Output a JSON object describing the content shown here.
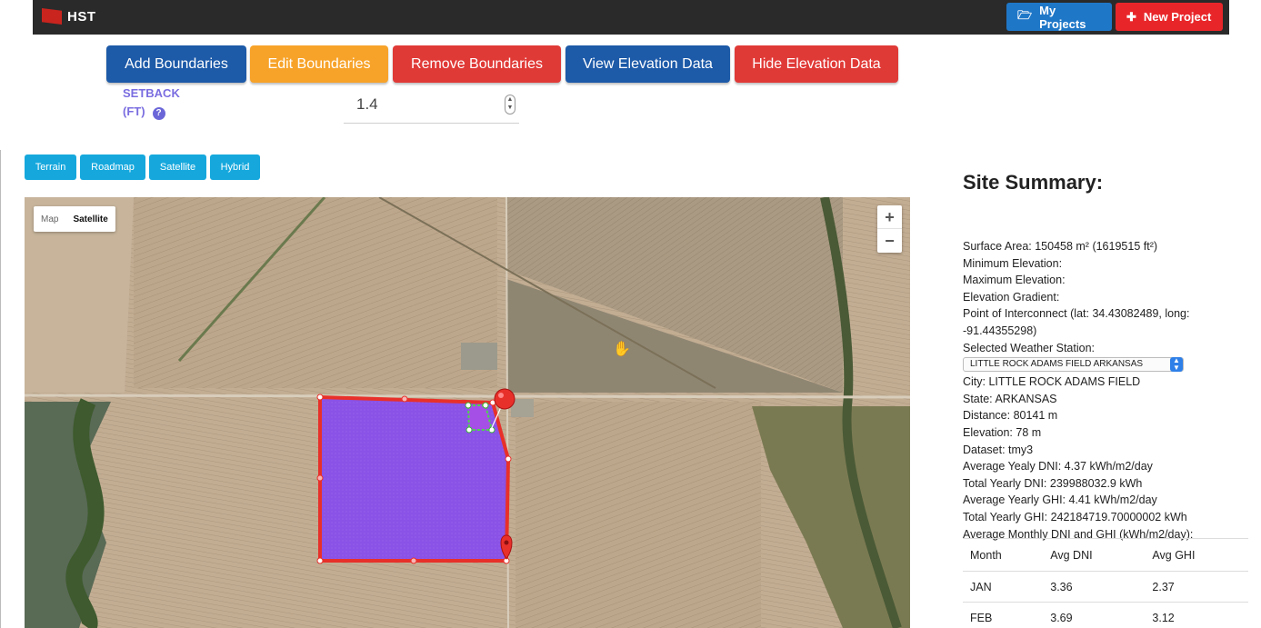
{
  "app": {
    "name": "HST"
  },
  "nav": {
    "my_projects": "My Projects",
    "new_project": "New Project",
    "projects_icon": "folder-open-icon",
    "new_icon": "plus-icon"
  },
  "actions": {
    "add": "Add Boundaries",
    "edit": "Edit Boundaries",
    "remove": "Remove Boundaries",
    "view": "View Elevation Data",
    "hide": "Hide Elevation Data"
  },
  "setback": {
    "label_line1": "SETBACK",
    "label_line2": "(FT)",
    "value": "1.4",
    "help_icon": "question-circle-icon"
  },
  "map_types": [
    "Terrain",
    "Roadmap",
    "Satellite",
    "Hybrid"
  ],
  "map": {
    "toggle_map": "Map",
    "toggle_satellite": "Satellite",
    "zoom_in": "+",
    "zoom_out": "−"
  },
  "summary": {
    "title": "Site Summary:",
    "surface_area": "Surface Area: 150458 m² (1619515 ft²)",
    "min_elev": "Minimum Elevation:",
    "max_elev": "Maximum Elevation:",
    "gradient": "Elevation Gradient:",
    "interconnect_1": "Point of Interconnect (lat: 34.43082489, long:",
    "interconnect_2": "-91.44355298)",
    "station_label": "Selected Weather Station:",
    "station_value": "LITTLE ROCK ADAMS FIELD ARKANSAS",
    "city": "City: LITTLE ROCK ADAMS FIELD",
    "state": "State: ARKANSAS",
    "distance": "Distance: 80141 m",
    "elevation": "Elevation: 78 m",
    "dataset": "Dataset: tmy3",
    "avg_dni": "Average Yealy DNI: 4.37 kWh/m2/day",
    "total_dni": "Total Yearly DNI: 239988032.9 kWh",
    "avg_ghi": "Average Yearly GHI: 4.41 kWh/m2/day",
    "total_ghi": "Total Yearly GHI: 242184719.70000002 kWh",
    "monthly_label": "Average Monthly DNI and GHI (kWh/m2/day):"
  },
  "monthly_table": {
    "headers": [
      "Month",
      "Avg DNI",
      "Avg GHI"
    ],
    "rows": [
      [
        "JAN",
        "3.36",
        "2.37"
      ],
      [
        "FEB",
        "3.69",
        "3.12"
      ]
    ]
  },
  "colors": {
    "boundary": "#e8302a",
    "fill": "#8a52e6",
    "primary": "#1d5aa8",
    "warning": "#f7a32a",
    "danger": "#e03a37",
    "info": "#16a8dd"
  }
}
